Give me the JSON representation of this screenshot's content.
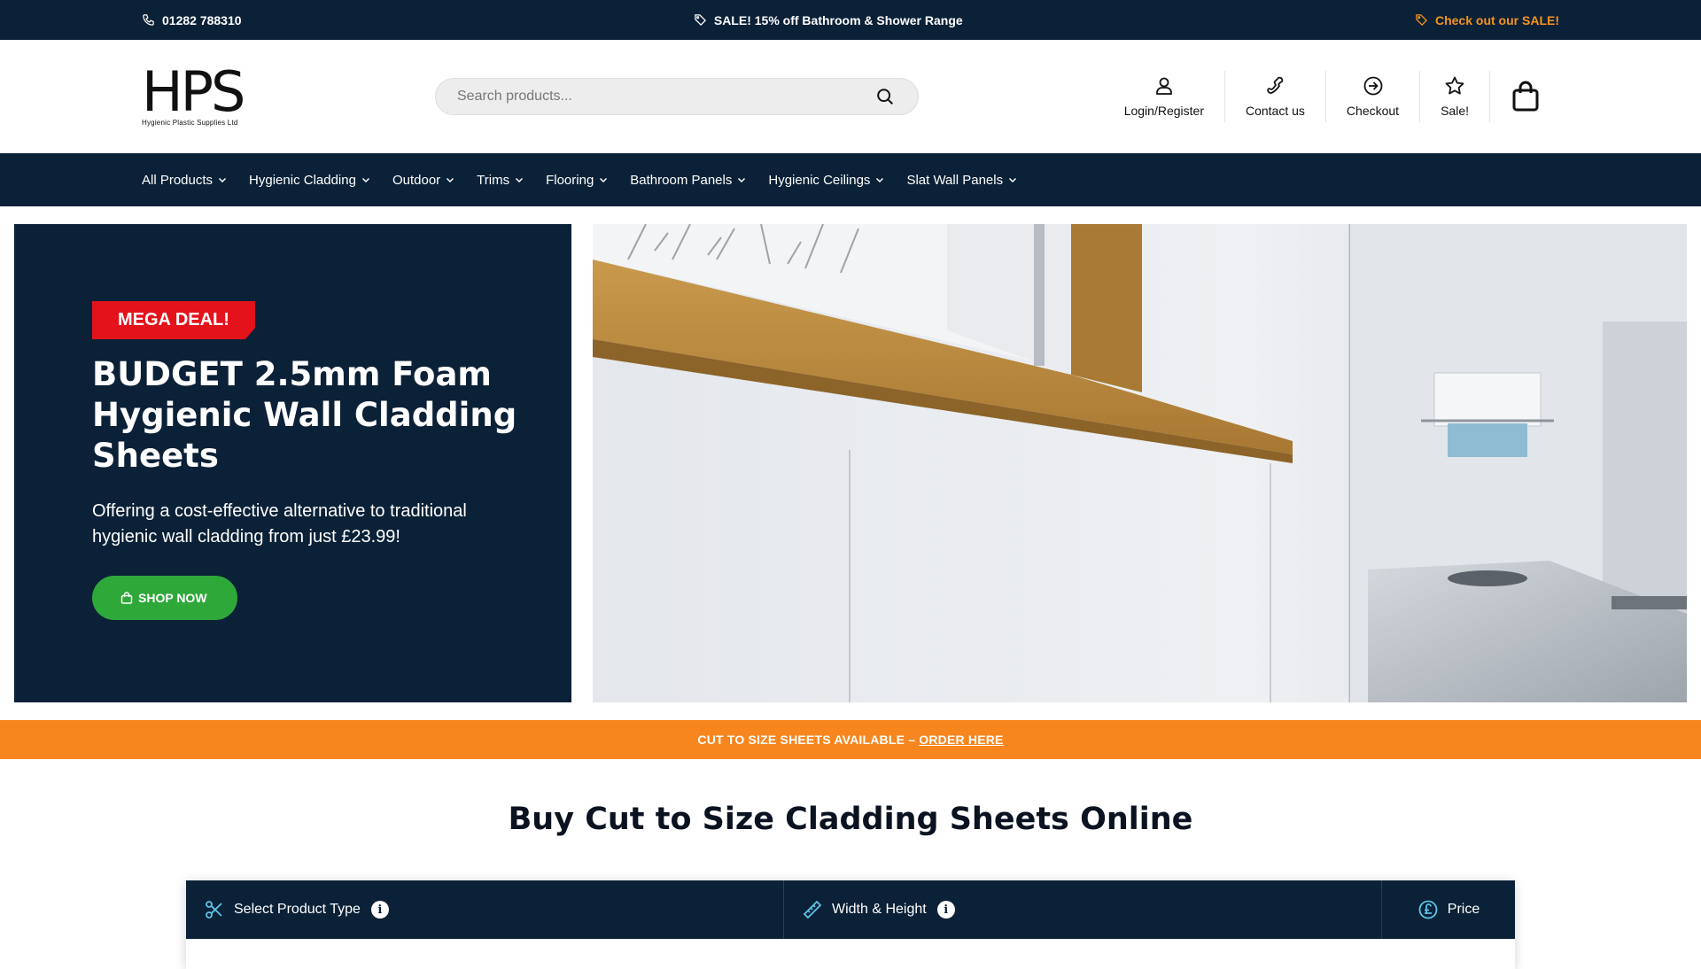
{
  "topbar": {
    "phone": "01282 788310",
    "promo": "SALE! 15% off Bathroom & Shower Range",
    "sale_link": "Check out our SALE!"
  },
  "header": {
    "logo_text": "HPS",
    "logo_subtitle": "Hygienic Plastic Supplies Ltd",
    "search_placeholder": "Search products...",
    "actions": [
      {
        "label": "Login/Register",
        "icon": "user-icon"
      },
      {
        "label": "Contact us",
        "icon": "phone-icon"
      },
      {
        "label": "Checkout",
        "icon": "arrow-circle-icon"
      },
      {
        "label": "Sale!",
        "icon": "star-icon"
      }
    ],
    "cart_icon": "shopping-bag-icon"
  },
  "nav": {
    "items": [
      "All Products",
      "Hygienic Cladding",
      "Outdoor",
      "Trims",
      "Flooring",
      "Bathroom Panels",
      "Hygienic Ceilings",
      "Slat Wall Panels"
    ]
  },
  "hero": {
    "badge": "MEGA DEAL!",
    "title": "BUDGET 2.5mm Foam Hygienic Wall Cladding Sheets",
    "text": "Offering a cost-effective alternative to traditional hygienic wall cladding from just £23.99!",
    "button": "SHOP NOW"
  },
  "promo_strip": {
    "text": "CUT TO SIZE SHEETS AVAILABLE –",
    "link": "ORDER HERE"
  },
  "section": {
    "title": "Buy Cut to Size Cladding Sheets Online"
  },
  "configurator": {
    "step1": "Select Product Type",
    "step2": "Width & Height",
    "step3": "Price"
  },
  "colors": {
    "navy": "#0b2137",
    "orange": "#f7861e",
    "red": "#e3121b",
    "green": "#2fa83a"
  }
}
